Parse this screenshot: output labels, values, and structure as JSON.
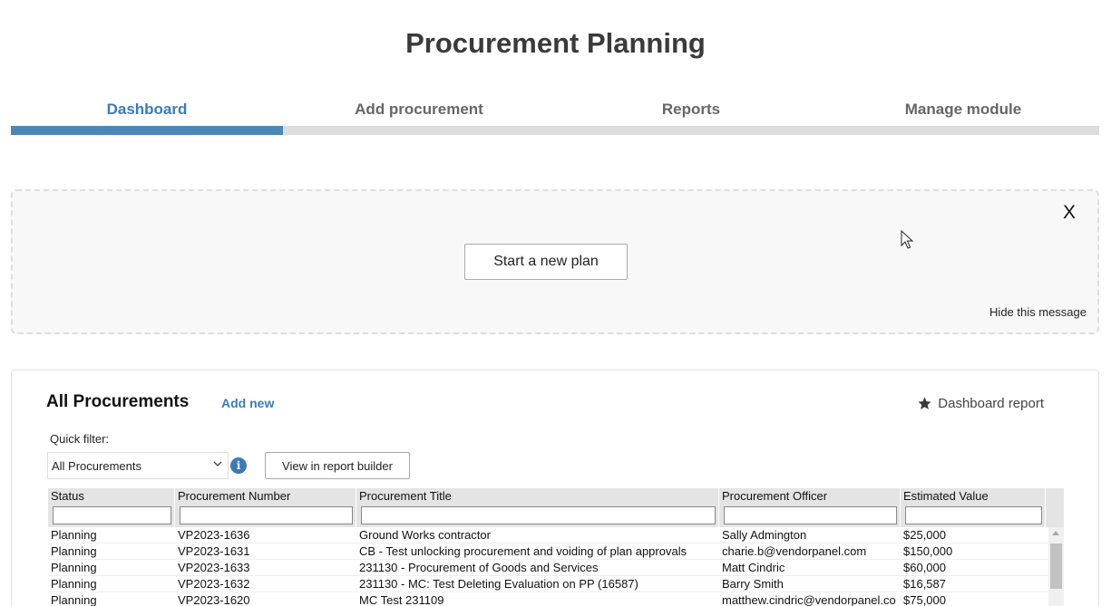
{
  "page_title": "Procurement Planning",
  "tabs": [
    {
      "label": "Dashboard",
      "active": true
    },
    {
      "label": "Add procurement",
      "active": false
    },
    {
      "label": "Reports",
      "active": false
    },
    {
      "label": "Manage module",
      "active": false
    }
  ],
  "banner": {
    "close_label": "X",
    "start_button": "Start a new plan",
    "hide_link": "Hide this message"
  },
  "panel": {
    "title": "All Procurements",
    "add_new": "Add new",
    "dashboard_report": "Dashboard report",
    "quick_filter_label": "Quick filter:",
    "quick_filter_value": "All Procurements",
    "view_button": "View in report builder"
  },
  "table": {
    "columns": [
      "Status",
      "Procurement Number",
      "Procurement Title",
      "Procurement Officer",
      "Estimated Value"
    ],
    "rows": [
      [
        "Planning",
        "VP2023-1636",
        "Ground Works contractor",
        "Sally Admington",
        "$25,000"
      ],
      [
        "Planning",
        "VP2023-1631",
        "CB - Test unlocking procurement and voiding of plan approvals",
        "charie.b@vendorpanel.com",
        "$150,000"
      ],
      [
        "Planning",
        "VP2023-1633",
        "231130 - Procurement of Goods and Services",
        "Matt Cindric",
        "$60,000"
      ],
      [
        "Planning",
        "VP2023-1632",
        "231130 - MC: Test Deleting Evaluation on PP (16587)",
        "Barry Smith",
        "$16,587"
      ],
      [
        "Planning",
        "VP2023-1620",
        "MC Test 231109",
        "matthew.cindric@vendorpanel.co",
        "$75,000"
      ]
    ]
  },
  "colors": {
    "accent": "#3d7ab5",
    "tab_inactive_bar": "#dddddd",
    "header_bg": "#e4e4e4"
  }
}
